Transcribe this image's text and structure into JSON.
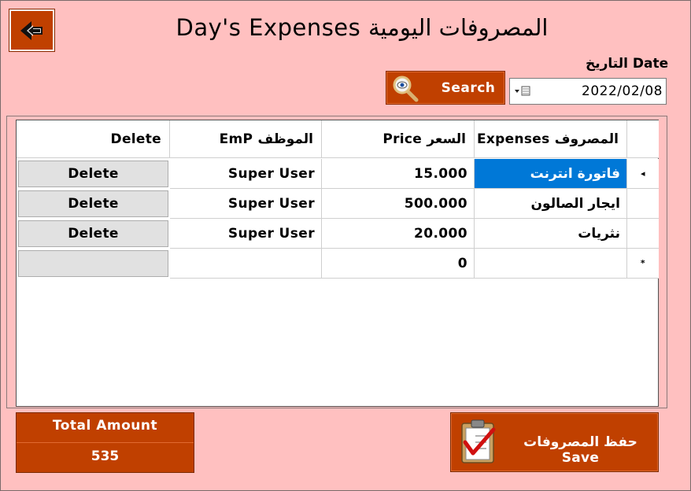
{
  "window": {
    "title": "Day's Expenses  المصروفات اليومية"
  },
  "date": {
    "label": "التاريخ Date",
    "value": "2022/02/08"
  },
  "search": {
    "label": "Search"
  },
  "grid": {
    "columns": [
      "Expenses المصروف",
      "Price السعر",
      "EmP الموظف",
      "Delete"
    ],
    "rows": [
      {
        "expense": "فاتورة انترنت",
        "price": "15.000",
        "emp": "Super User",
        "delete": "Delete"
      },
      {
        "expense": "ايجار الصالون",
        "price": "500.000",
        "emp": "Super User",
        "delete": "Delete"
      },
      {
        "expense": "نثريات",
        "price": "20.000",
        "emp": "Super User",
        "delete": "Delete"
      }
    ],
    "new_row": {
      "price": "0"
    },
    "row_markers": {
      "current": "◂",
      "new": "*"
    }
  },
  "total": {
    "label": "Total Amount",
    "value": "535"
  },
  "save": {
    "label": "حفظ المصروفات Save"
  },
  "colors": {
    "accent": "#c04000",
    "background": "#ffc0c0",
    "selection": "#0078d7"
  }
}
